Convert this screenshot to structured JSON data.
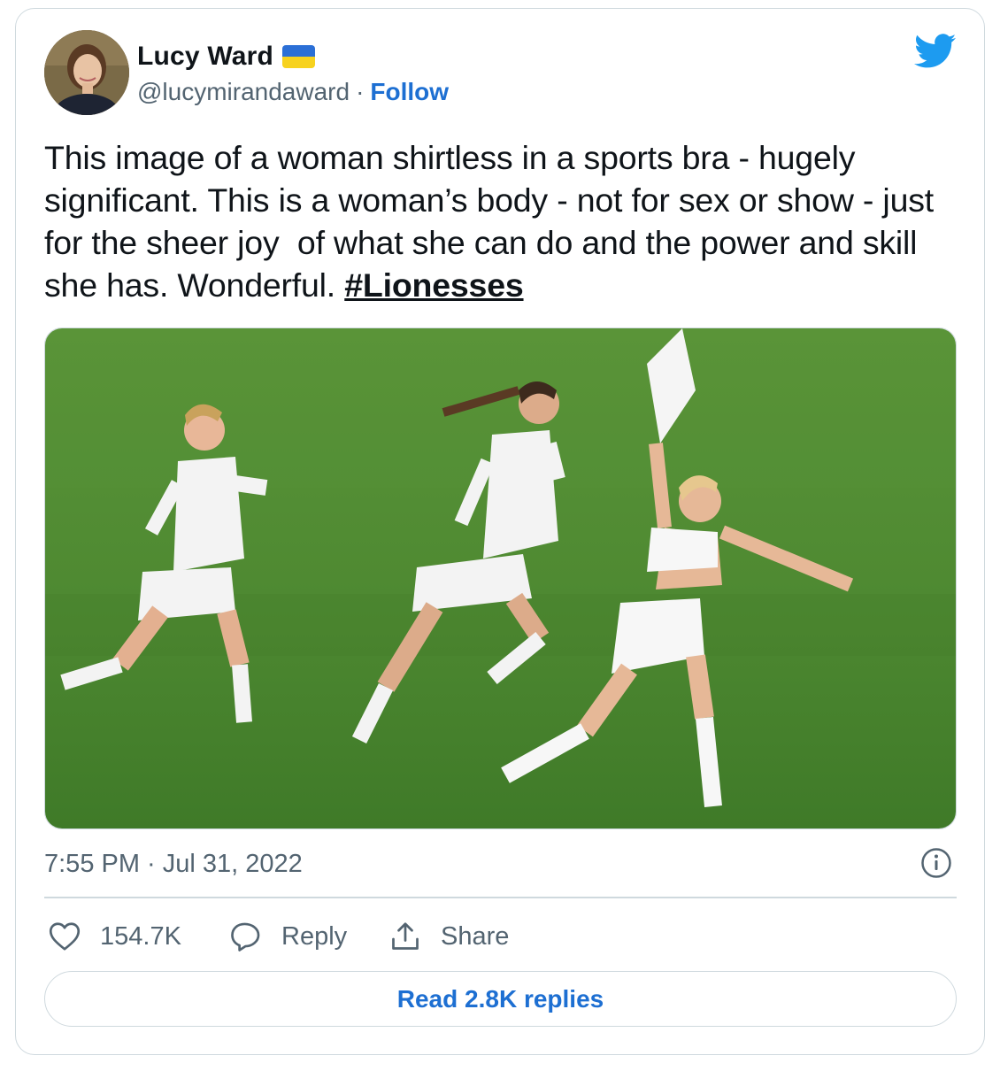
{
  "author": {
    "name": "Lucy Ward",
    "handle": "@lucymirandaward",
    "separator": "·",
    "follow_label": "Follow",
    "flag_icon": "ukraine-flag-icon"
  },
  "brand_icon": "twitter-bird-icon",
  "tweet": {
    "text": "This image of a woman shirtless in a sports bra - hugely significant. This is a woman’s body - not for sex or show - just for the sheer joy  of what she can do and the power and skill she has. Wonderful. ",
    "hashtag": "#Lionesses",
    "timestamp": "7:55 PM · Jul 31, 2022"
  },
  "actions": {
    "like_count": "154.7K",
    "reply_label": "Reply",
    "share_label": "Share"
  },
  "read_replies_label": "Read 2.8K replies",
  "colors": {
    "link_blue": "#1d6fd2",
    "twitter_blue": "#1d9bf0",
    "secondary_text": "#536471",
    "border": "#cfd9de",
    "pitch_green": "#4f8a32"
  }
}
